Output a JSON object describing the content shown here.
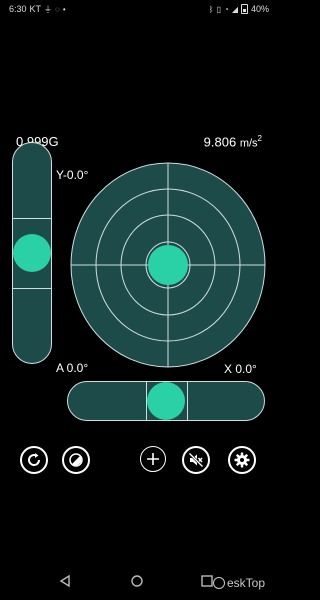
{
  "status_bar": {
    "time": "6:30",
    "carrier": "KT",
    "battery": "40%",
    "icons": [
      "bluetooth-icon",
      "vibrate-icon",
      "wifi-icon",
      "signal-icon",
      "battery-icon"
    ]
  },
  "readouts": {
    "gravity": "0.999G",
    "acceleration_value": "9.806",
    "acceleration_unit": "m/s",
    "acceleration_exp": "2"
  },
  "axes": {
    "y_label": "Y-0.0°",
    "a_label": "A  0.0°",
    "x_label": "X  0.0°"
  },
  "levels": {
    "vertical_bubble": 0.5,
    "horizontal_bubble": 0.5,
    "circular_bubble_x": 0.5,
    "circular_bubble_y": 0.5
  },
  "colors": {
    "level_fill": "#1d4b4a",
    "bubble": "#2bd1a6",
    "line": "#cfdede"
  },
  "toolbar": {
    "buttons": [
      {
        "name": "calibrate-button",
        "icon": "refresh-icon"
      },
      {
        "name": "theme-button",
        "icon": "contrast-icon"
      },
      {
        "name": "add-button",
        "icon": "plus-icon"
      },
      {
        "name": "sound-button",
        "icon": "speaker-muted-icon"
      },
      {
        "name": "settings-button",
        "icon": "gear-icon"
      }
    ]
  },
  "watermark": {
    "text": "eskTop"
  }
}
